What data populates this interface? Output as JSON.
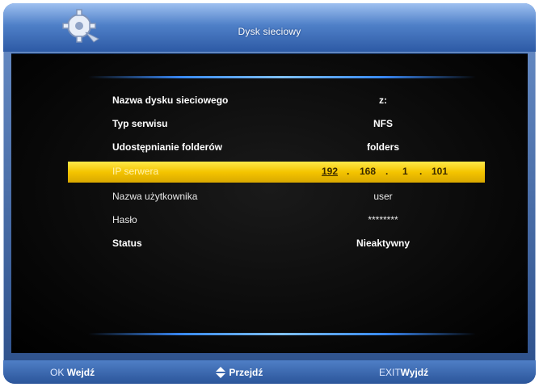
{
  "header": {
    "title": "Dysk sieciowy",
    "icon": "gear-icon"
  },
  "settings": {
    "rows": [
      {
        "label": "Nazwa dysku sieciowego",
        "value": "z:"
      },
      {
        "label": "Typ serwisu",
        "value": "NFS"
      },
      {
        "label": "Udostępnianie folderów",
        "value": "folders"
      },
      {
        "label": "IP serwera",
        "ip": [
          "192",
          "168",
          "1",
          "101"
        ],
        "dots": [
          "."
        ]
      },
      {
        "label": "Nazwa użytkownika",
        "value": "user"
      },
      {
        "label": "Hasło",
        "value": "********"
      },
      {
        "label": "Status",
        "value": "Nieaktywny"
      }
    ],
    "selected_index": 3
  },
  "footer": {
    "ok_key": "OK",
    "ok_action": "Wejdź",
    "nav_action": "Przejdź",
    "exit_key": "EXIT",
    "exit_action": "Wyjdź"
  },
  "colors": {
    "highlight": "#f4c400",
    "frame_blue": "#2d5aa5",
    "glow_blue": "#3b8dff"
  }
}
